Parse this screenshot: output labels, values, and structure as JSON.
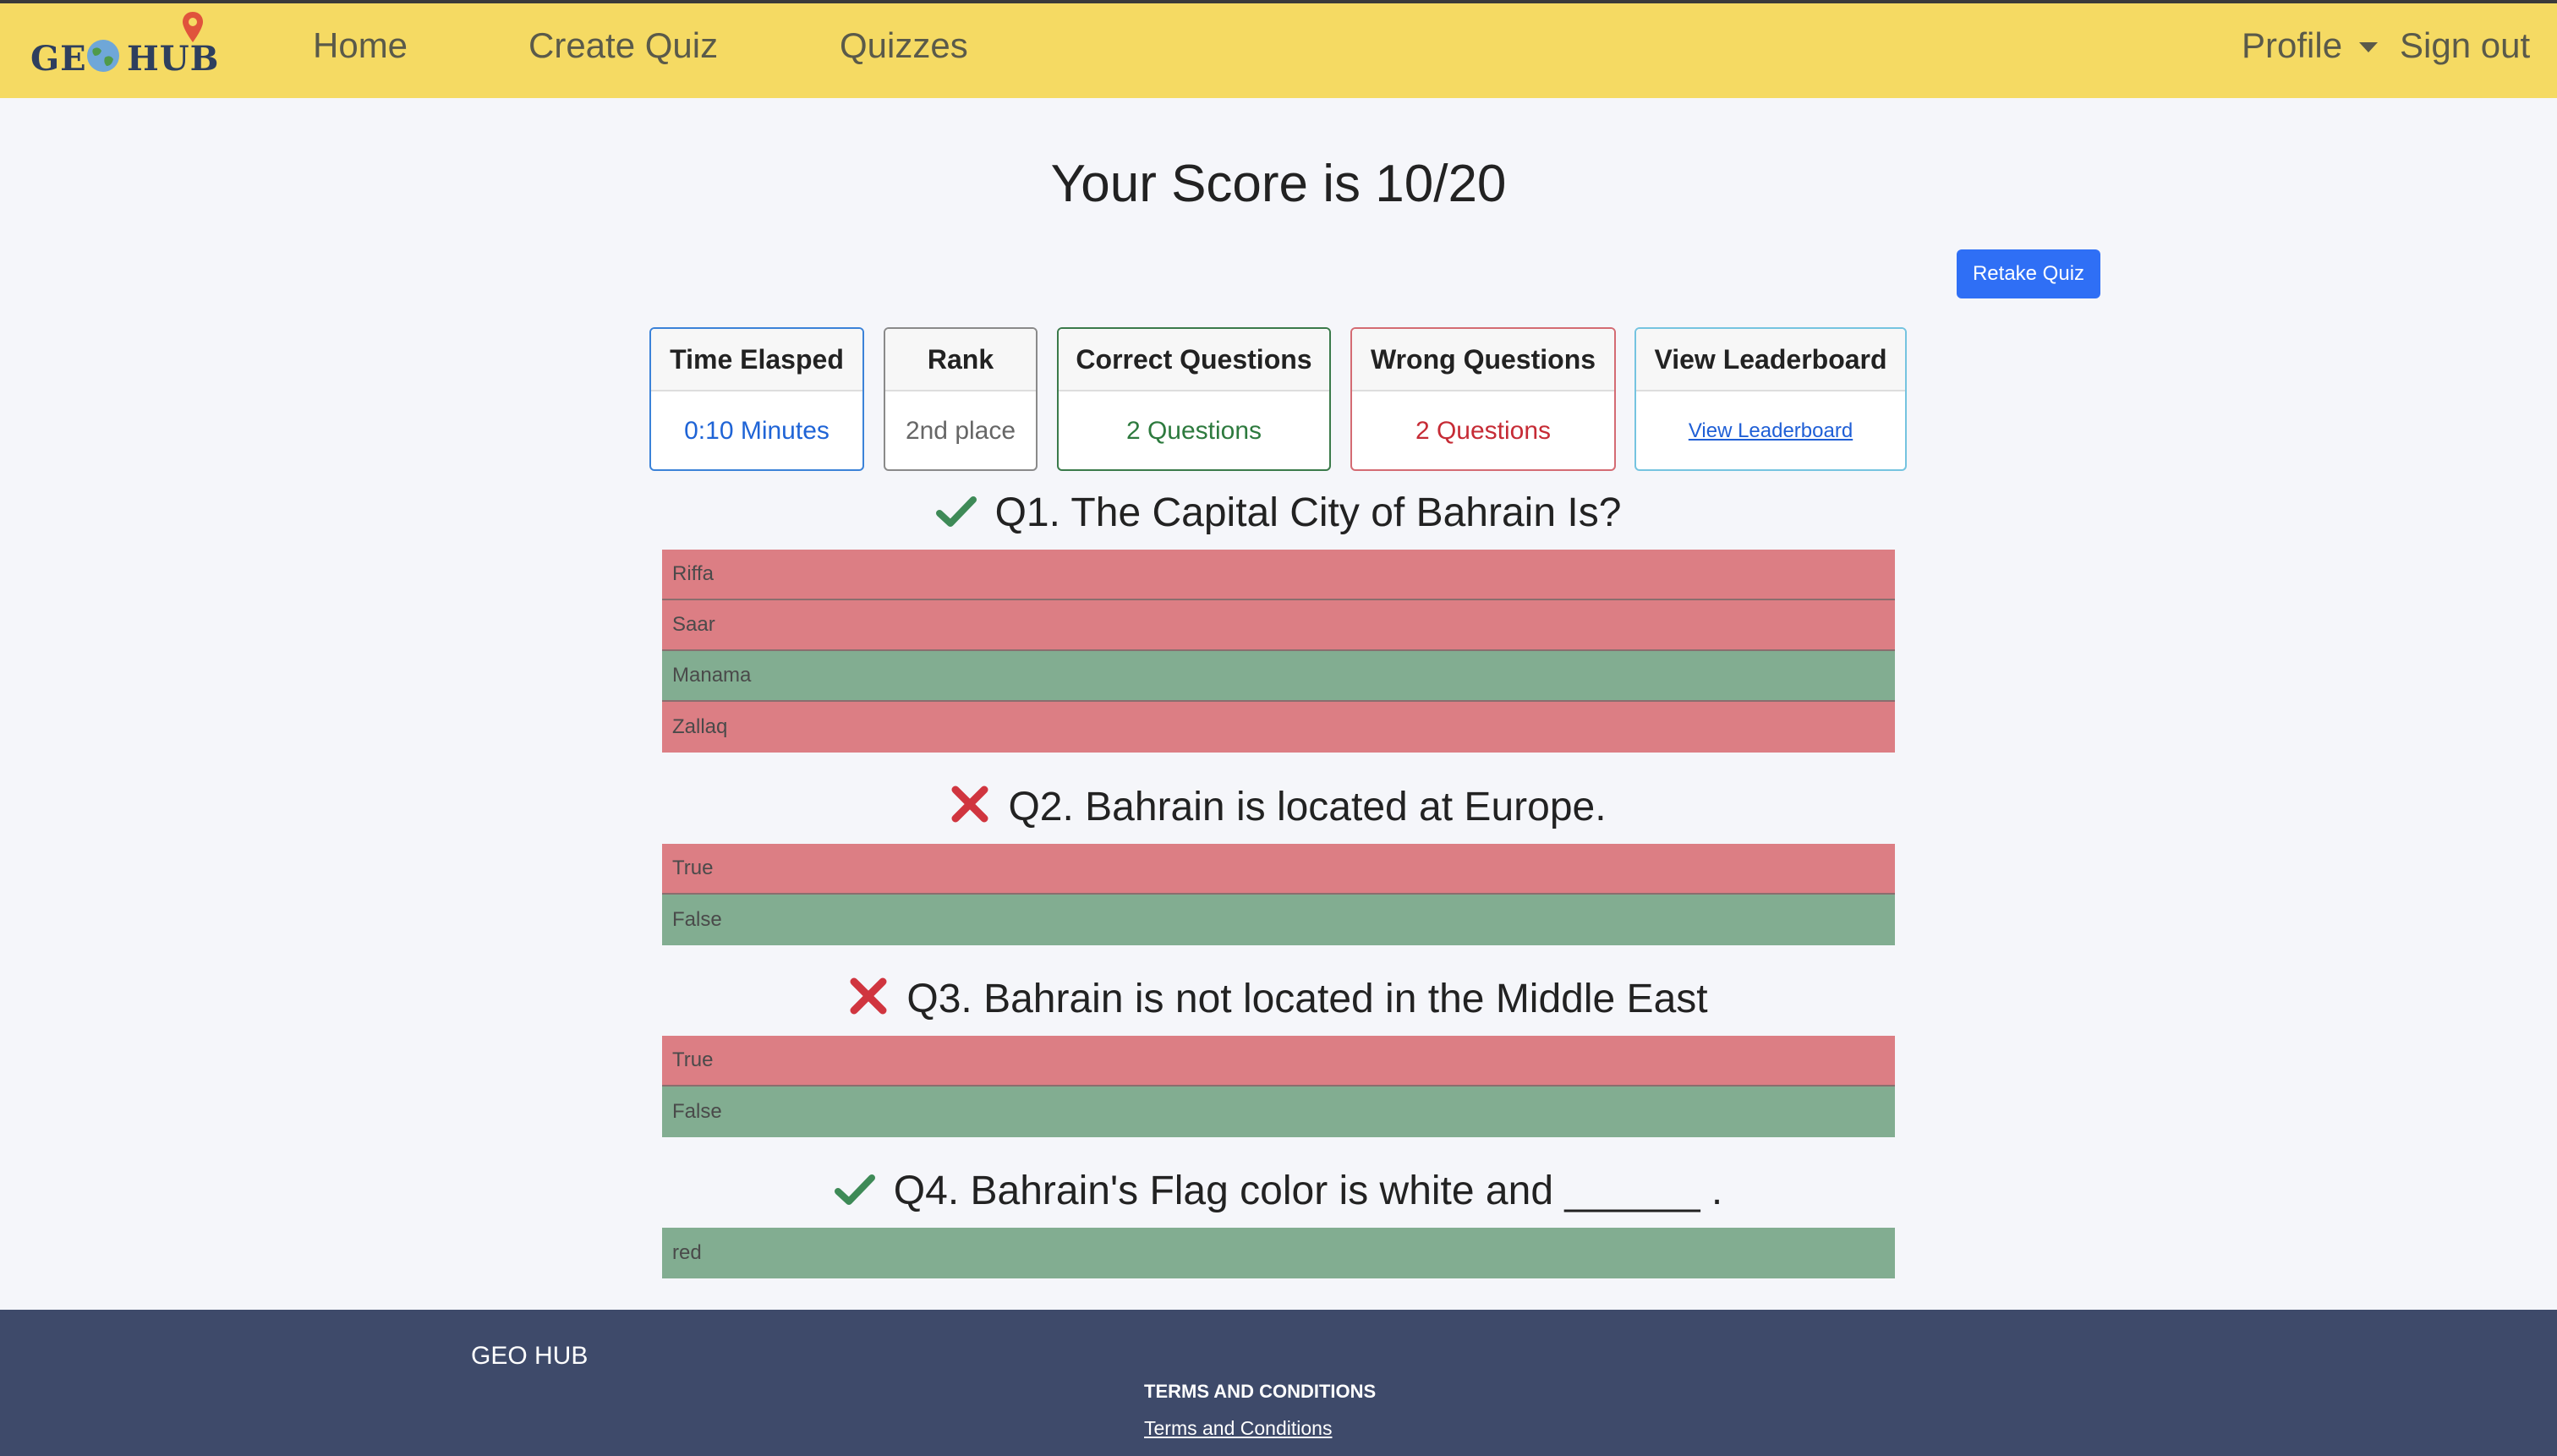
{
  "nav": {
    "logo_geo": "GE",
    "logo_hub": "HUB",
    "home": "Home",
    "create_quiz": "Create Quiz",
    "quizzes": "Quizzes",
    "profile": "Profile",
    "sign_out": "Sign out"
  },
  "score_title": "Your Score is 10/20",
  "retake_label": "Retake Quiz",
  "stats": {
    "time": {
      "label": "Time Elasped",
      "value": "0:10 Minutes"
    },
    "rank": {
      "label": "Rank",
      "value": "2nd place"
    },
    "correct": {
      "label": "Correct Questions",
      "value": "2 Questions"
    },
    "wrong": {
      "label": "Wrong Questions",
      "value": "2 Questions"
    },
    "leaderboard": {
      "label": "View Leaderboard",
      "link": "View Leaderboard"
    }
  },
  "questions": [
    {
      "title": "Q1. The Capital City of Bahrain Is?",
      "result": "correct",
      "answers": [
        {
          "text": "Riffa",
          "state": "wrong"
        },
        {
          "text": "Saar",
          "state": "wrong"
        },
        {
          "text": "Manama",
          "state": "right"
        },
        {
          "text": "Zallaq",
          "state": "wrong"
        }
      ]
    },
    {
      "title": "Q2. Bahrain is located at Europe.",
      "result": "incorrect",
      "answers": [
        {
          "text": "True",
          "state": "wrong"
        },
        {
          "text": "False",
          "state": "right"
        }
      ]
    },
    {
      "title": "Q3. Bahrain is not located in the Middle East",
      "result": "incorrect",
      "answers": [
        {
          "text": "True",
          "state": "wrong"
        },
        {
          "text": "False",
          "state": "right"
        }
      ]
    },
    {
      "title": "Q4. Bahrain's Flag color is white and ______ .",
      "result": "correct",
      "answers": [
        {
          "text": "red",
          "state": "right"
        }
      ]
    }
  ],
  "footer": {
    "brand": "GEO HUB",
    "terms_heading": "TERMS AND CONDITIONS",
    "terms_link": "Terms and Conditions"
  },
  "colors": {
    "navbar": "#f5da63",
    "wrong_answer": "#dc7e84",
    "right_answer": "#82ad91",
    "footer": "#3e4a6a",
    "primary_button": "#2f6ff5"
  }
}
